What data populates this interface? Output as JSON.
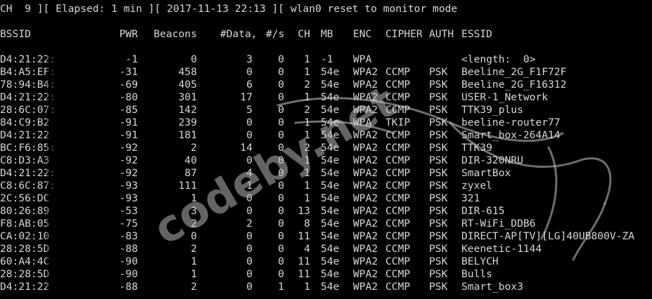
{
  "status_line": "CH  9 ][ Elapsed: 1 min ][ 2017-11-13 22:13 ][ wlan0 reset to monitor mode",
  "headers": {
    "bssid": "BSSID",
    "pwr": "PWR",
    "beacons": "Beacons",
    "data": "#Data,",
    "per_s": "#/s",
    "ch": "CH",
    "mb": "MB",
    "enc": "ENC",
    "cipher": "CIPHER",
    "auth": "AUTH",
    "essid": "ESSID"
  },
  "rows": [
    {
      "bssid": "D4:21:22:",
      "pwr": "-1",
      "beacons": "0",
      "data": "3",
      "per_s": "0",
      "ch": "1",
      "mb": "-1",
      "enc": "WPA",
      "cipher": "",
      "auth": "",
      "essid": "<length:  0>"
    },
    {
      "bssid": "B4:A5:EF:",
      "pwr": "-31",
      "beacons": "458",
      "data": "0",
      "per_s": "0",
      "ch": "1",
      "mb": "54e",
      "enc": "WPA2",
      "cipher": "CCMP",
      "auth": "PSK",
      "essid": "Beeline_2G_F1F72F"
    },
    {
      "bssid": "78:94:B4:",
      "pwr": "-69",
      "beacons": "405",
      "data": "6",
      "per_s": "0",
      "ch": "2",
      "mb": "54e",
      "enc": "WPA2",
      "cipher": "CCMP",
      "auth": "PSK",
      "essid": "Beeline_2G_F16312"
    },
    {
      "bssid": "D4:21:22:",
      "pwr": "-80",
      "beacons": "301",
      "data": "17",
      "per_s": "0",
      "ch": "1",
      "mb": "54e",
      "enc": "WPA2",
      "cipher": "CCMP",
      "auth": "PSK",
      "essid": "USER-1_Network"
    },
    {
      "bssid": "28:6C:07:",
      "pwr": "-85",
      "beacons": "142",
      "data": "5",
      "per_s": "0",
      "ch": "2",
      "mb": "54e",
      "enc": "WPA2",
      "cipher": "CCMP",
      "auth": "PSK",
      "essid": "TTK39_plus"
    },
    {
      "bssid": "84:C9:B2",
      "pwr": "-91",
      "beacons": "239",
      "data": "0",
      "per_s": "0",
      "ch": "1",
      "mb": "54e",
      "enc": "WPA",
      "cipher": "TKIP",
      "auth": "PSK",
      "essid": "beeline-router77"
    },
    {
      "bssid": "D4:21:22",
      "pwr": "-91",
      "beacons": "181",
      "data": "0",
      "per_s": "0",
      "ch": "1",
      "mb": "54e",
      "enc": "WPA2",
      "cipher": "CCMP",
      "auth": "PSK",
      "essid": "Smart_box-264A14"
    },
    {
      "bssid": "BC:F6:85:",
      "pwr": "-92",
      "beacons": "2",
      "data": "14",
      "per_s": "0",
      "ch": "2",
      "mb": "54e",
      "enc": "WPA2",
      "cipher": "CCMP",
      "auth": "PSK",
      "essid": "TTK39"
    },
    {
      "bssid": "C8:D3:A3",
      "pwr": "-92",
      "beacons": "40",
      "data": "0",
      "per_s": "0",
      "ch": "1",
      "mb": "54e",
      "enc": "WPA2",
      "cipher": "CCMP",
      "auth": "PSK",
      "essid": "DIR-320NRU"
    },
    {
      "bssid": "D4:21:22:",
      "pwr": "-92",
      "beacons": "87",
      "data": "4",
      "per_s": "0",
      "ch": "1",
      "mb": "54e",
      "enc": "WPA2",
      "cipher": "CCMP",
      "auth": "PSK",
      "essid": "SmartBox"
    },
    {
      "bssid": "C8:6C:87:",
      "pwr": "-93",
      "beacons": "111",
      "data": "1",
      "per_s": "0",
      "ch": "1",
      "mb": "54e",
      "enc": "WPA2",
      "cipher": "CCMP",
      "auth": "PSK",
      "essid": "zyxel"
    },
    {
      "bssid": "2C:56:DC",
      "pwr": "-93",
      "beacons": "1",
      "data": "0",
      "per_s": "0",
      "ch": "1",
      "mb": "54e",
      "enc": "WPA2",
      "cipher": "CCMP",
      "auth": "PSK",
      "essid": "321"
    },
    {
      "bssid": "80:26:89",
      "pwr": "-53",
      "beacons": "3",
      "data": "0",
      "per_s": "0",
      "ch": "13",
      "mb": "54e",
      "enc": "WPA2",
      "cipher": "CCMP",
      "auth": "PSK",
      "essid": "DIR-615"
    },
    {
      "bssid": "F8:AB:05",
      "pwr": "-75",
      "beacons": "2",
      "data": "2",
      "per_s": "0",
      "ch": "8",
      "mb": "54e",
      "enc": "WPA2",
      "cipher": "CCMP",
      "auth": "PSK",
      "essid": "RT-WiFi_DDB6"
    },
    {
      "bssid": "CA:02:10",
      "pwr": "-83",
      "beacons": "0",
      "data": "0",
      "per_s": "0",
      "ch": "11",
      "mb": "54e",
      "enc": "WPA2",
      "cipher": "CCMP",
      "auth": "PSK",
      "essid": "DIRECT-AP[TV][LG]40UB800V-ZA"
    },
    {
      "bssid": "28:28:5D",
      "pwr": "-88",
      "beacons": "2",
      "data": "0",
      "per_s": "0",
      "ch": "4",
      "mb": "54e",
      "enc": "WPA2",
      "cipher": "CCMP",
      "auth": "PSK",
      "essid": "Keenetic-1144"
    },
    {
      "bssid": "60:A4:4C",
      "pwr": "-90",
      "beacons": "1",
      "data": "0",
      "per_s": "0",
      "ch": "11",
      "mb": "54e",
      "enc": "WPA2",
      "cipher": "CCMP",
      "auth": "PSK",
      "essid": "BELYCH"
    },
    {
      "bssid": "28:28:5D",
      "pwr": "-90",
      "beacons": "1",
      "data": "0",
      "per_s": "0",
      "ch": "11",
      "mb": "54e",
      "enc": "WPA2",
      "cipher": "CCMP",
      "auth": "PSK",
      "essid": "Bulls"
    },
    {
      "bssid": "D4:21:22",
      "pwr": "-88",
      "beacons": "2",
      "data": "0",
      "per_s": "1",
      "ch": "1",
      "mb": "54e",
      "enc": "WPA2",
      "cipher": "CCMP",
      "auth": "PSK",
      "essid": "Smart_box3"
    }
  ],
  "watermark": {
    "text": "codeby.net",
    "icon": "kali-dragon-icon"
  },
  "colors": {
    "background": "#000000",
    "text": "#d8d8d8",
    "watermark": "#c8c8c8"
  }
}
